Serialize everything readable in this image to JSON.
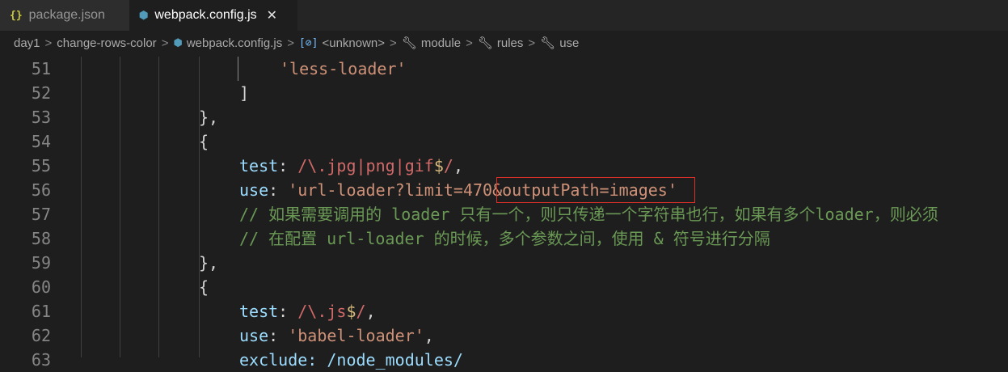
{
  "tabs": [
    {
      "label": "package.json",
      "icon": "json-icon",
      "active": false
    },
    {
      "label": "webpack.config.js",
      "icon": "webpack-icon",
      "active": true
    }
  ],
  "breadcrumb": {
    "items": [
      "day1",
      "change-rows-color",
      "webpack.config.js",
      "<unknown>",
      "module",
      "rules",
      "use"
    ],
    "separator": ">"
  },
  "editor": {
    "lines": [
      {
        "num": "51",
        "tokens": [
          {
            "t": "'less-loader'",
            "c": "str"
          }
        ]
      },
      {
        "num": "52",
        "tokens": [
          {
            "t": "]",
            "c": "punc"
          }
        ]
      },
      {
        "num": "53",
        "tokens": [
          {
            "t": "},",
            "c": "punc"
          }
        ]
      },
      {
        "num": "54",
        "tokens": [
          {
            "t": "{",
            "c": "punc"
          }
        ]
      },
      {
        "num": "55",
        "tokens": [
          {
            "t": "test",
            "c": "prop"
          },
          {
            "t": ": ",
            "c": "punc"
          },
          {
            "t": "/\\.jpg|png|gif",
            "c": "regex"
          },
          {
            "t": "$",
            "c": "esc"
          },
          {
            "t": "/",
            "c": "regex"
          },
          {
            "t": ",",
            "c": "punc"
          }
        ]
      },
      {
        "num": "56",
        "tokens": [
          {
            "t": "use",
            "c": "prop"
          },
          {
            "t": ": ",
            "c": "punc"
          },
          {
            "t": "'url-loader?limit=470&outputPath=images'",
            "c": "str"
          }
        ]
      },
      {
        "num": "57",
        "tokens": [
          {
            "t": "// 如果需要调用的 loader 只有一个，则只传递一个字符串也行，如果有多个loader，则必须",
            "c": "cmt"
          }
        ]
      },
      {
        "num": "58",
        "tokens": [
          {
            "t": "// 在配置 url-loader 的时候，多个参数之间，使用 & 符号进行分隔",
            "c": "cmt"
          }
        ]
      },
      {
        "num": "59",
        "tokens": [
          {
            "t": "},",
            "c": "punc"
          }
        ]
      },
      {
        "num": "60",
        "tokens": [
          {
            "t": "{",
            "c": "punc"
          }
        ]
      },
      {
        "num": "61",
        "tokens": [
          {
            "t": "test",
            "c": "prop"
          },
          {
            "t": ": ",
            "c": "punc"
          },
          {
            "t": "/\\.js",
            "c": "regex"
          },
          {
            "t": "$",
            "c": "esc"
          },
          {
            "t": "/",
            "c": "regex"
          },
          {
            "t": ",",
            "c": "punc"
          }
        ]
      },
      {
        "num": "62",
        "tokens": [
          {
            "t": "use",
            "c": "prop"
          },
          {
            "t": ": ",
            "c": "punc"
          },
          {
            "t": "'babel-loader'",
            "c": "str"
          },
          {
            "t": ",",
            "c": "punc"
          }
        ]
      },
      {
        "num": "63",
        "tokens": [
          {
            "t": "exclude: /node_modules/",
            "c": "prop"
          }
        ]
      }
    ]
  },
  "colors": {
    "background": "#1e1e1e",
    "string": "#ce9178",
    "property": "#9cdcfe",
    "regex": "#d16969",
    "comment": "#6a9955",
    "highlight_border": "#d9312a"
  }
}
